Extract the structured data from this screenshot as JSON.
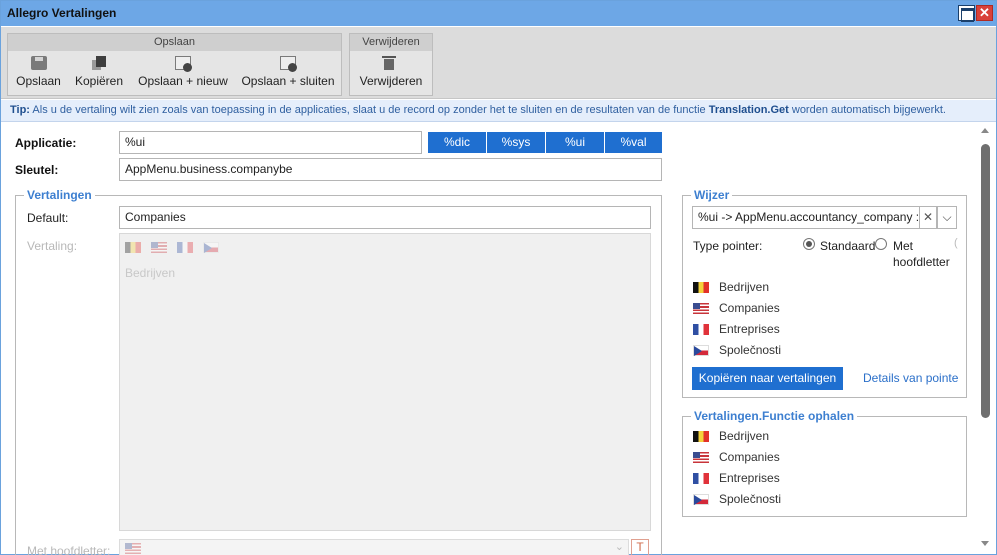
{
  "window": {
    "title": "Allegro Vertalingen"
  },
  "ribbon": {
    "save_group_title": "Opslaan",
    "save": "Opslaan",
    "copy": "Kopiëren",
    "save_new": "Opslaan + nieuw",
    "save_close": "Opslaan + sluiten",
    "delete_group_title": "Verwijderen",
    "delete": "Verwijderen"
  },
  "tip": {
    "prefix": "Tip:",
    "text": " Als u de vertaling wilt zien zoals van toepassing in de applicaties, slaat u de record op zonder het te sluiten en de resultaten van de functie ",
    "function": "Translation.Get",
    "suffix": " worden automatisch bijgewerkt."
  },
  "form": {
    "applicatie_label": "Applicatie:",
    "applicatie_value": "%ui",
    "tags": [
      "%dic",
      "%sys",
      "%ui",
      "%val"
    ],
    "sleutel_label": "Sleutel:",
    "sleutel_value": "AppMenu.business.companybe"
  },
  "vertalingen": {
    "legend": "Vertalingen",
    "default_label": "Default:",
    "default_value": "Companies",
    "vertaling_label": "Vertaling:",
    "vertaling_text": "Bedrijven",
    "hoofdletter_label": "Met hoofdletter:"
  },
  "wijzer": {
    "legend": "Wijzer",
    "combo_value": "%ui -> AppMenu.accountancy_company :",
    "type_label": "Type pointer:",
    "option_standard": "Standaard",
    "option_caps_1": "Met",
    "option_caps_2": "hoofdletter",
    "items": [
      {
        "flag": "be",
        "text": "Bedrijven"
      },
      {
        "flag": "us",
        "text": "Companies"
      },
      {
        "flag": "fr",
        "text": "Entreprises"
      },
      {
        "flag": "cz",
        "text": "Společnosti"
      }
    ],
    "copy_button": "Kopiëren naar vertalingen",
    "details_link": "Details van pointe"
  },
  "functie": {
    "legend": "Vertalingen.Functie ophalen",
    "items": [
      {
        "flag": "be",
        "text": "Bedrijven"
      },
      {
        "flag": "us",
        "text": "Companies"
      },
      {
        "flag": "fr",
        "text": "Entreprises"
      },
      {
        "flag": "cz",
        "text": "Společnosti"
      }
    ]
  }
}
